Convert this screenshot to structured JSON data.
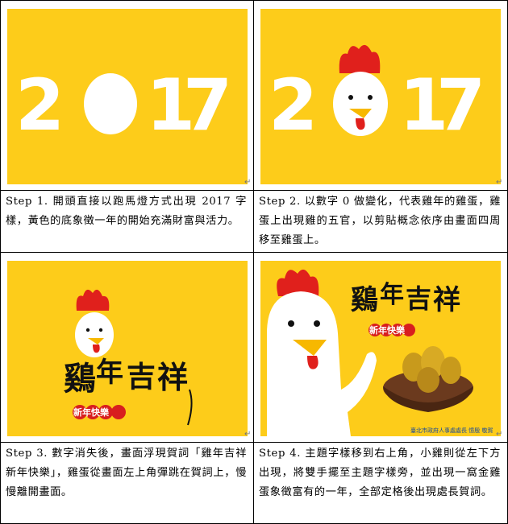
{
  "steps": [
    {
      "caption": "Step 1. 開頭直接以跑馬燈方式出現 2017 字樣，黃色的底象徵一年的開始充滿財富與活力。",
      "year_digits": [
        "2",
        "1",
        "7"
      ]
    },
    {
      "caption": "Step 2. 以數字 0 做變化，代表雞年的雞蛋，雞蛋上出現雞的五官，以剪貼概念依序由畫面四周移至雞蛋上。",
      "year_digits": [
        "2",
        "1",
        "7"
      ]
    },
    {
      "caption": "Step 3. 數字消失後，畫面浮現賀詞「雞年吉祥 新年快樂」，雞蛋從畫面左上角彈跳在賀詞上，慢慢離開畫面。",
      "callig_chars": [
        "鷄",
        "年",
        "吉",
        "祥"
      ],
      "greeting": "新年快樂"
    },
    {
      "caption": "Step 4. 主題字樣移到右上角，小雞則從左下方出現，將雙手擺至主題字樣旁，並出現一窩金雞蛋象徵富有的一年，全部定格後出現處長賀詞。",
      "callig_chars": [
        "鷄",
        "年",
        "吉",
        "祥"
      ],
      "greeting": "新年快樂",
      "footer": "臺北市政府人事處處長 憶殷 敬賀"
    }
  ],
  "colors": {
    "panel_bg": "#fdcc1a",
    "comb": "#e0201c",
    "beak": "#f7b800",
    "gold": "#c89a1c"
  },
  "paragraph_mark": "↵"
}
